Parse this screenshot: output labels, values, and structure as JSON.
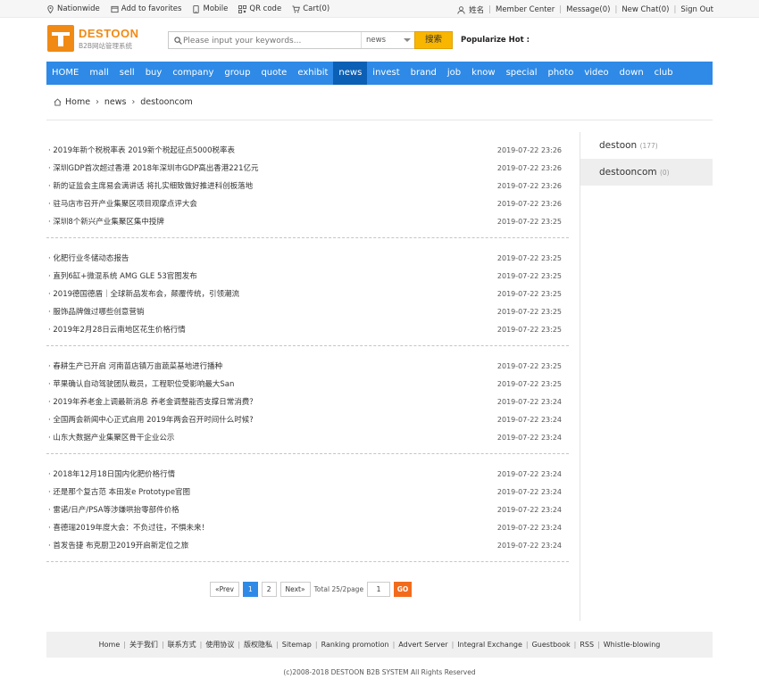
{
  "topbar": {
    "left": [
      {
        "icon": "location-pin-icon",
        "label": "Nationwide"
      },
      {
        "icon": "favorites-icon",
        "label": "Add to favorites"
      },
      {
        "icon": "mobile-icon",
        "label": "Mobile"
      },
      {
        "icon": "qr-code-icon",
        "label": "QR code"
      },
      {
        "icon": "cart-icon",
        "label": "Cart(0)"
      }
    ],
    "right": [
      "姓名",
      "Member Center",
      "Message(0)",
      "New Chat(0)",
      "Sign Out"
    ],
    "user_icon": "user-icon"
  },
  "logo": {
    "brand": "DESTOON",
    "sub": "B2B网站管理系统"
  },
  "search": {
    "placeholder": "Please input your keywords...",
    "category": "news",
    "button": "搜索"
  },
  "popular_label": "Popularize Hot :",
  "nav": [
    "HOME",
    "mall",
    "sell",
    "buy",
    "company",
    "group",
    "quote",
    "exhibit",
    "news",
    "invest",
    "brand",
    "job",
    "know",
    "special",
    "photo",
    "video",
    "down",
    "club"
  ],
  "nav_active": "news",
  "breadcrumb": [
    "Home",
    "news",
    "destooncom"
  ],
  "news_groups": [
    [
      {
        "title": "· 2019年新个税税率表 2019新个税起征点5000税率表",
        "date": "2019-07-22 23:26"
      },
      {
        "title": "· 深圳GDP首次超过香港 2018年深圳市GDP高出香港221亿元",
        "date": "2019-07-22 23:26"
      },
      {
        "title": "· 新的证监会主席易会满讲话 将扎实细致做好推进科创板落地",
        "date": "2019-07-22 23:26"
      },
      {
        "title": "· 驻马店市召开产业集聚区项目观摩点评大会",
        "date": "2019-07-22 23:26"
      },
      {
        "title": "· 深圳8个新兴产业集聚区集中授牌",
        "date": "2019-07-22 23:25"
      }
    ],
    [
      {
        "title": "· 化肥行业冬储动态报告",
        "date": "2019-07-22 23:25"
      },
      {
        "title": "· 直列6缸+微混系统 AMG GLE 53官图发布",
        "date": "2019-07-22 23:25"
      },
      {
        "title": "· 2019德国德盾｜全球新品发布会，颠覆传统，引领潮流",
        "date": "2019-07-22 23:25"
      },
      {
        "title": "· 服饰品牌做过哪些创意营销",
        "date": "2019-07-22 23:25"
      },
      {
        "title": "· 2019年2月28日云南地区花生价格行情",
        "date": "2019-07-22 23:25"
      }
    ],
    [
      {
        "title": "· 春耕生产已开启 河南苗店镇万亩蔬菜基地进行播种",
        "date": "2019-07-22 23:25"
      },
      {
        "title": "· 苹果确认自动驾驶团队裁员，工程职位受影响最大San",
        "date": "2019-07-22 23:25"
      },
      {
        "title": "· 2019年养老金上调最新消息 养老金调整能否支撑日常消费？",
        "date": "2019-07-22 23:24"
      },
      {
        "title": "· 全国两会新闻中心正式启用 2019年两会召开时间什么时候?",
        "date": "2019-07-22 23:24"
      },
      {
        "title": "· 山东大数据产业集聚区骨干企业公示",
        "date": "2019-07-22 23:24"
      }
    ],
    [
      {
        "title": "· 2018年12月18日国内化肥价格行情",
        "date": "2019-07-22 23:24"
      },
      {
        "title": "· 还是那个复古范 本田发e Prototype官图",
        "date": "2019-07-22 23:24"
      },
      {
        "title": "· 雷诺/日产/PSA等涉嫌哄抬零部件价格",
        "date": "2019-07-22 23:24"
      },
      {
        "title": "· 喜德瑞2019年度大会：不负过往，不惧未来！",
        "date": "2019-07-22 23:24"
      },
      {
        "title": "· 首发告捷 布克厨卫2019开启新定位之旅",
        "date": "2019-07-22 23:24"
      }
    ]
  ],
  "sidebar": [
    {
      "label": "destoon",
      "count": "(177)"
    },
    {
      "label": "destooncom",
      "count": "(0)"
    }
  ],
  "sidebar_active": "destooncom",
  "pager": {
    "prev": "«Prev",
    "pages": [
      "1",
      "2"
    ],
    "current": "1",
    "next": "Next»",
    "total": "Total 25/2page",
    "input": "1",
    "go": "GO"
  },
  "footer_links": [
    "Home",
    "关于我们",
    "联系方式",
    "使用协议",
    "版权隐私",
    "Sitemap",
    "Ranking promotion",
    "Advert Server",
    "Integral Exchange",
    "Guestbook",
    "RSS",
    "Whistle-blowing"
  ],
  "copyright": "(c)2008-2018 DESTOON B2B SYSTEM All Rights Reserved",
  "colors": {
    "nav_bg": "#2e8ae6",
    "nav_active": "#0b5fb5",
    "brand_orange": "#f08a14",
    "search_btn": "#f9b600",
    "go_btn": "#f26b1d"
  }
}
